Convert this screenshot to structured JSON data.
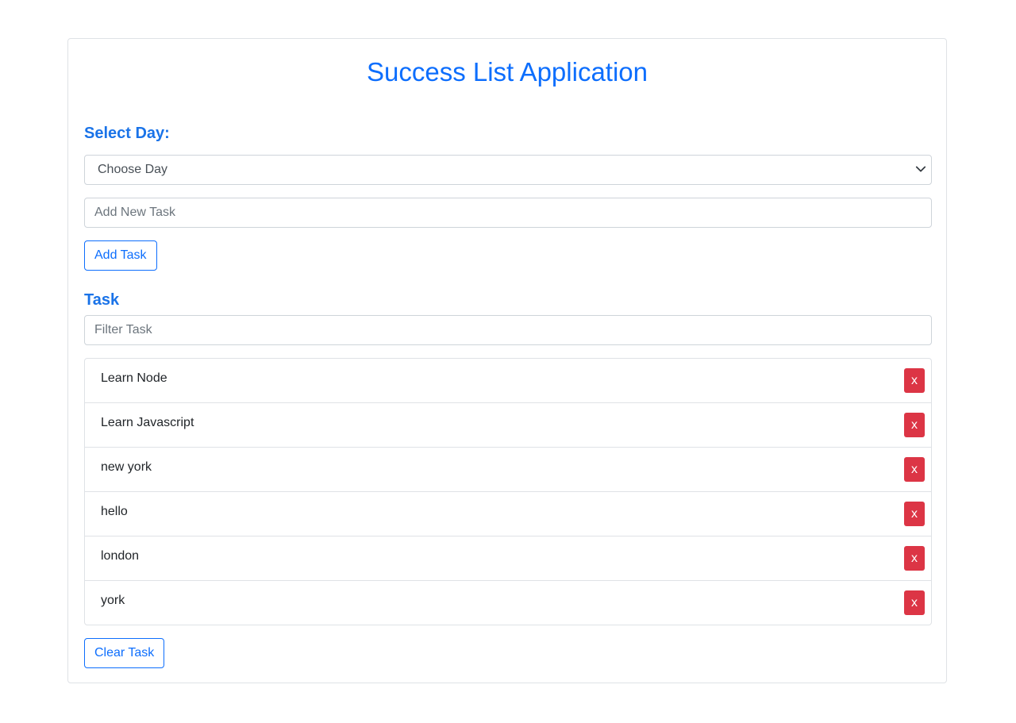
{
  "app": {
    "title": "Success List Application"
  },
  "day_section": {
    "label": "Select Day:",
    "select_value": "Choose Day"
  },
  "new_task": {
    "placeholder": "Add New Task",
    "value": "",
    "button_label": "Add Task"
  },
  "task_section": {
    "label": "Task",
    "filter_placeholder": "Filter Task",
    "filter_value": "",
    "items": [
      {
        "text": "Learn Node",
        "delete_label": "x"
      },
      {
        "text": "Learn Javascript",
        "delete_label": "x"
      },
      {
        "text": "new york",
        "delete_label": "x"
      },
      {
        "text": "hello",
        "delete_label": "x"
      },
      {
        "text": "london",
        "delete_label": "x"
      },
      {
        "text": "york",
        "delete_label": "x"
      }
    ],
    "clear_button_label": "Clear Task"
  },
  "colors": {
    "accent": "#0d6efd",
    "danger": "#dc3545"
  },
  "icons": {
    "select_arrow": "chevron-down-icon"
  }
}
